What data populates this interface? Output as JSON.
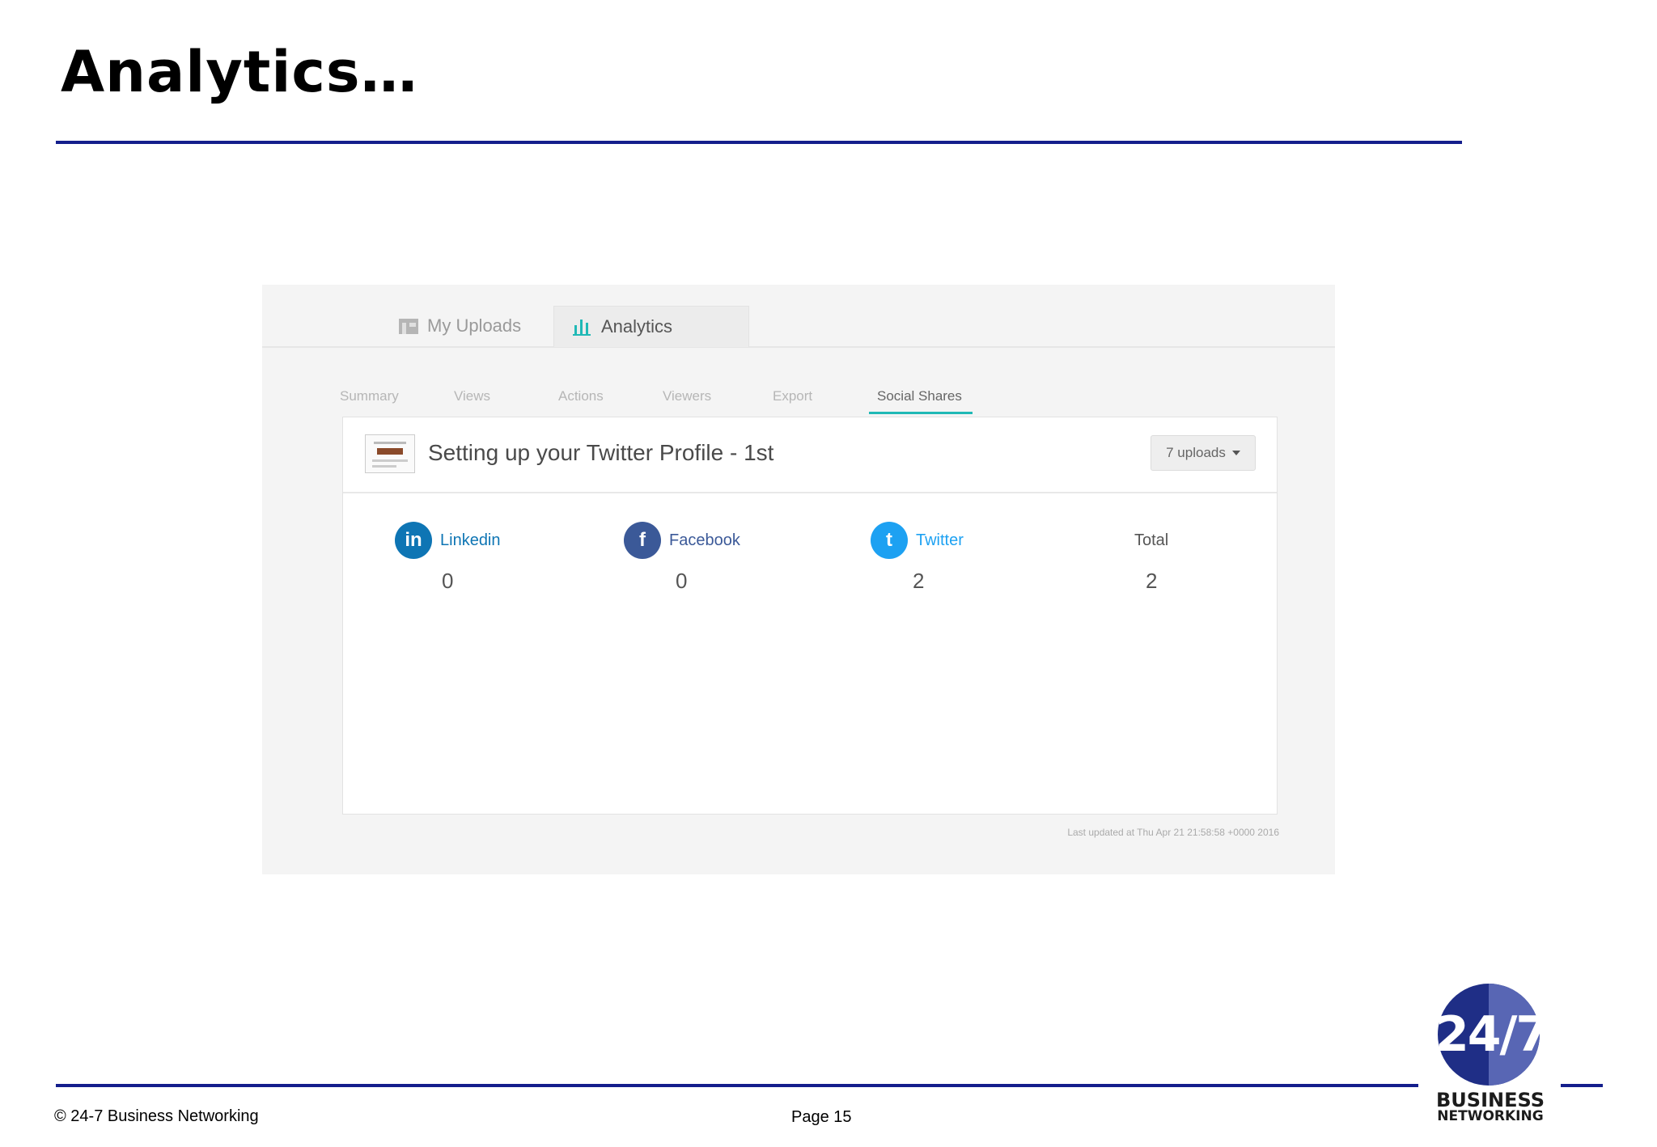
{
  "slide": {
    "title": "Analytics…",
    "footer_copyright": "© 24-7 Business Networking",
    "footer_page": "Page 15"
  },
  "tabs": [
    {
      "label": "My Uploads",
      "icon": "folder-icon",
      "active": false
    },
    {
      "label": "Analytics",
      "icon": "bar-chart-icon",
      "active": true
    }
  ],
  "subtabs": [
    "Summary",
    "Views",
    "Actions",
    "Viewers",
    "Export",
    "Social Shares"
  ],
  "active_subtab": "Social Shares",
  "document": {
    "title": "Setting up your Twitter Profile - 1st",
    "uploads_dropdown": "7 uploads"
  },
  "stats": {
    "linkedin": {
      "label": "Linkedin",
      "value": "0",
      "icon_glyph": "in"
    },
    "facebook": {
      "label": "Facebook",
      "value": "0",
      "icon_glyph": "f"
    },
    "twitter": {
      "label": "Twitter",
      "value": "2",
      "icon_glyph": "t"
    },
    "total": {
      "label": "Total",
      "value": "2"
    }
  },
  "last_updated": "Last updated at Thu Apr 21 21:58:58 +0000 2016",
  "logo": {
    "number": "24/7",
    "line1": "BUSINESS",
    "line2": "NETWORKING"
  },
  "colors": {
    "accent": "#141e8c",
    "teal": "#20b9b6",
    "linkedin": "#0e75b4",
    "facebook": "#3b5998",
    "twitter": "#1da1f2"
  }
}
